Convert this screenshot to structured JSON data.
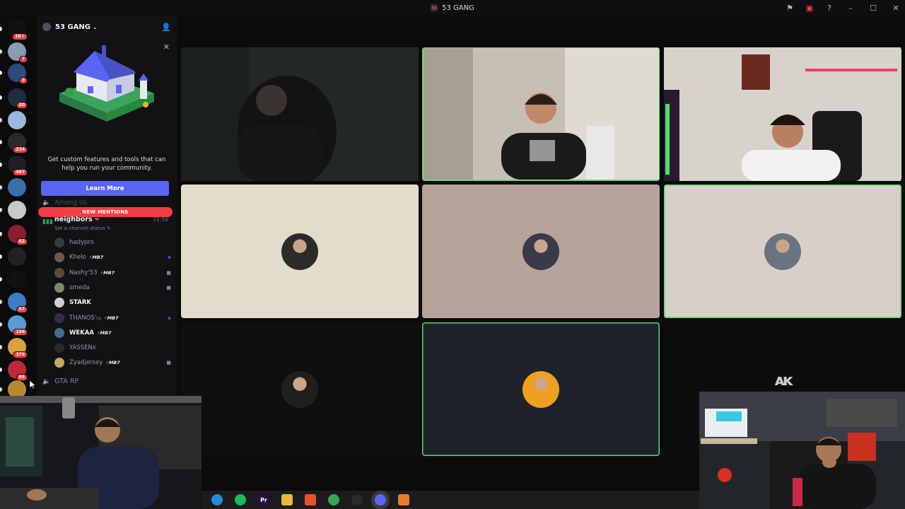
{
  "window": {
    "title": "53 GANG",
    "title_icon_text": "5x"
  },
  "rail": {
    "servers": [
      {
        "badge": "1K+",
        "color": "#5865f2"
      },
      {
        "badge": "7",
        "color": "#8a9bb3"
      },
      {
        "badge": "3",
        "color": "#2d4a7a"
      },
      {
        "badge": "20",
        "color": "#1d2f3f"
      },
      {
        "badge": "",
        "color": "#9ab8d9"
      },
      {
        "badge": "234",
        "color": "#2a2a2e"
      },
      {
        "badge": "487",
        "color": "#1e1e24"
      },
      {
        "badge": "",
        "color": "#3a6ea8"
      },
      {
        "badge": "",
        "color": "#c9c9c9"
      },
      {
        "badge": "62",
        "color": "#8a1f2d"
      },
      {
        "badge": "",
        "color": "#222"
      },
      {
        "badge": "",
        "color": "#111"
      },
      {
        "badge": "57",
        "color": "#3b7cc9"
      },
      {
        "badge": "196",
        "color": "#5a9bd5"
      },
      {
        "badge": "376",
        "color": "#d9a23a"
      },
      {
        "badge": "65",
        "color": "#c0283a"
      },
      {
        "badge": "",
        "color": "#b8892c"
      }
    ]
  },
  "sidebar": {
    "server_name": "53 GANG",
    "promo": {
      "text": "Get custom features and tools that can help you run your community.",
      "button": "Learn More"
    },
    "faded_category": "Among Us",
    "new_mentions": "NEW MENTIONS",
    "active_channel": {
      "name": "neighbors",
      "time": "21:56",
      "status_placeholder": "Set a channel status"
    },
    "members": [
      {
        "name": "hadypro",
        "tag": "",
        "bold": false,
        "icon": "",
        "color": "#3a3a3a"
      },
      {
        "name": "Khelo",
        "tag": "MB7",
        "bold": false,
        "icon": "activity",
        "color": "#6b5a4a"
      },
      {
        "name": "Nashy'53",
        "tag": "MB7",
        "bold": false,
        "icon": "camera",
        "color": "#5a4a3a"
      },
      {
        "name": "smeda",
        "tag": "",
        "bold": false,
        "icon": "camera",
        "color": "#7a8a6a"
      },
      {
        "name": "STARK",
        "tag": "",
        "bold": true,
        "icon": "",
        "color": "#cfcfcf"
      },
      {
        "name": "THANOS'₅₃",
        "tag": "MB7",
        "bold": false,
        "icon": "activity",
        "color": "#3a2a4a"
      },
      {
        "name": "WEKAA",
        "tag": "MB7",
        "bold": true,
        "icon": "",
        "color": "#4a6a8a"
      },
      {
        "name": "YASSENx",
        "tag": "",
        "bold": false,
        "icon": "",
        "color": "#2a2a2a"
      },
      {
        "name": "Zyadjersey",
        "tag": "MB7",
        "bold": false,
        "icon": "camera",
        "color": "#c8a85a"
      }
    ],
    "next_channel": "GTA RP"
  },
  "video_grid": {
    "tiles": [
      {
        "type": "video",
        "bg": "#1c211f",
        "speaking": false
      },
      {
        "type": "video",
        "bg": "#c6bfb4",
        "speaking": true
      },
      {
        "type": "video",
        "bg": "#d8d2cc",
        "speaking": false
      },
      {
        "type": "avatar",
        "bg": "#e4dccb",
        "speaking": false,
        "avatar_color": "#2b2b2b"
      },
      {
        "type": "avatar",
        "bg": "#b7a39a",
        "speaking": false,
        "avatar_color": "#3a3a48"
      },
      {
        "type": "avatar",
        "bg": "#d8d0c8",
        "speaking": true,
        "avatar_color": "#6b7380"
      },
      {
        "type": "avatar",
        "bg": "#0f0f10",
        "speaking": false,
        "avatar_color": "#1f1f1f"
      },
      {
        "type": "avatar",
        "bg": "#1e232b",
        "speaking": true,
        "avatar_color": "#f0a020"
      },
      {
        "type": "logo",
        "bg": "#0d0d0e",
        "speaking": false
      }
    ]
  },
  "taskbar": {
    "apps": [
      {
        "name": "edge",
        "color": "#1f8fd6",
        "label": ""
      },
      {
        "name": "spotify",
        "color": "#1db954",
        "label": ""
      },
      {
        "name": "premiere",
        "color": "#2a0a4a",
        "label": "Pr"
      },
      {
        "name": "files",
        "color": "#e8b83a",
        "label": ""
      },
      {
        "name": "brave",
        "color": "#e8542a",
        "label": ""
      },
      {
        "name": "chrome",
        "color": "#34a853",
        "label": ""
      },
      {
        "name": "obs",
        "color": "#2a2a2a",
        "label": ""
      },
      {
        "name": "discord",
        "color": "#5865f2",
        "label": ""
      },
      {
        "name": "other",
        "color": "#e87a2a",
        "label": ""
      }
    ]
  }
}
